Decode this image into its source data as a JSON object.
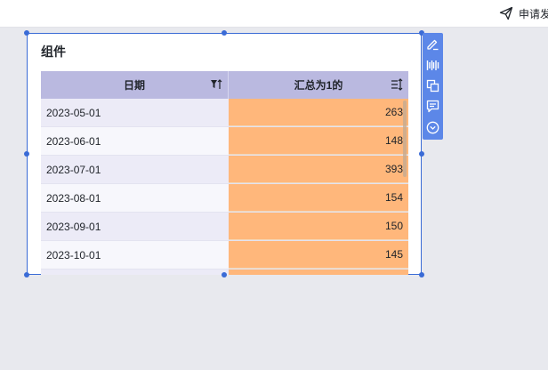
{
  "header": {
    "apply_label": "申请发"
  },
  "widget": {
    "title": "组件",
    "columns": {
      "date": "日期",
      "value": "汇总为1的"
    },
    "rows": [
      {
        "date": "2023-05-01",
        "value": "263"
      },
      {
        "date": "2023-06-01",
        "value": "148"
      },
      {
        "date": "2023-07-01",
        "value": "393"
      },
      {
        "date": "2023-08-01",
        "value": "154"
      },
      {
        "date": "2023-09-01",
        "value": "150"
      },
      {
        "date": "2023-10-01",
        "value": "145"
      },
      {
        "date": "",
        "value": ""
      }
    ]
  },
  "toolbar": {
    "icons": [
      "edit-icon",
      "barcode-icon",
      "copy-icon",
      "comment-icon",
      "chevron-down-circle-icon"
    ]
  },
  "colors": {
    "selection_blue": "#3a6bd6",
    "header_purple": "#bab9e0",
    "value_orange": "#ffb77b",
    "toolbar_blue": "#5c87e8"
  }
}
